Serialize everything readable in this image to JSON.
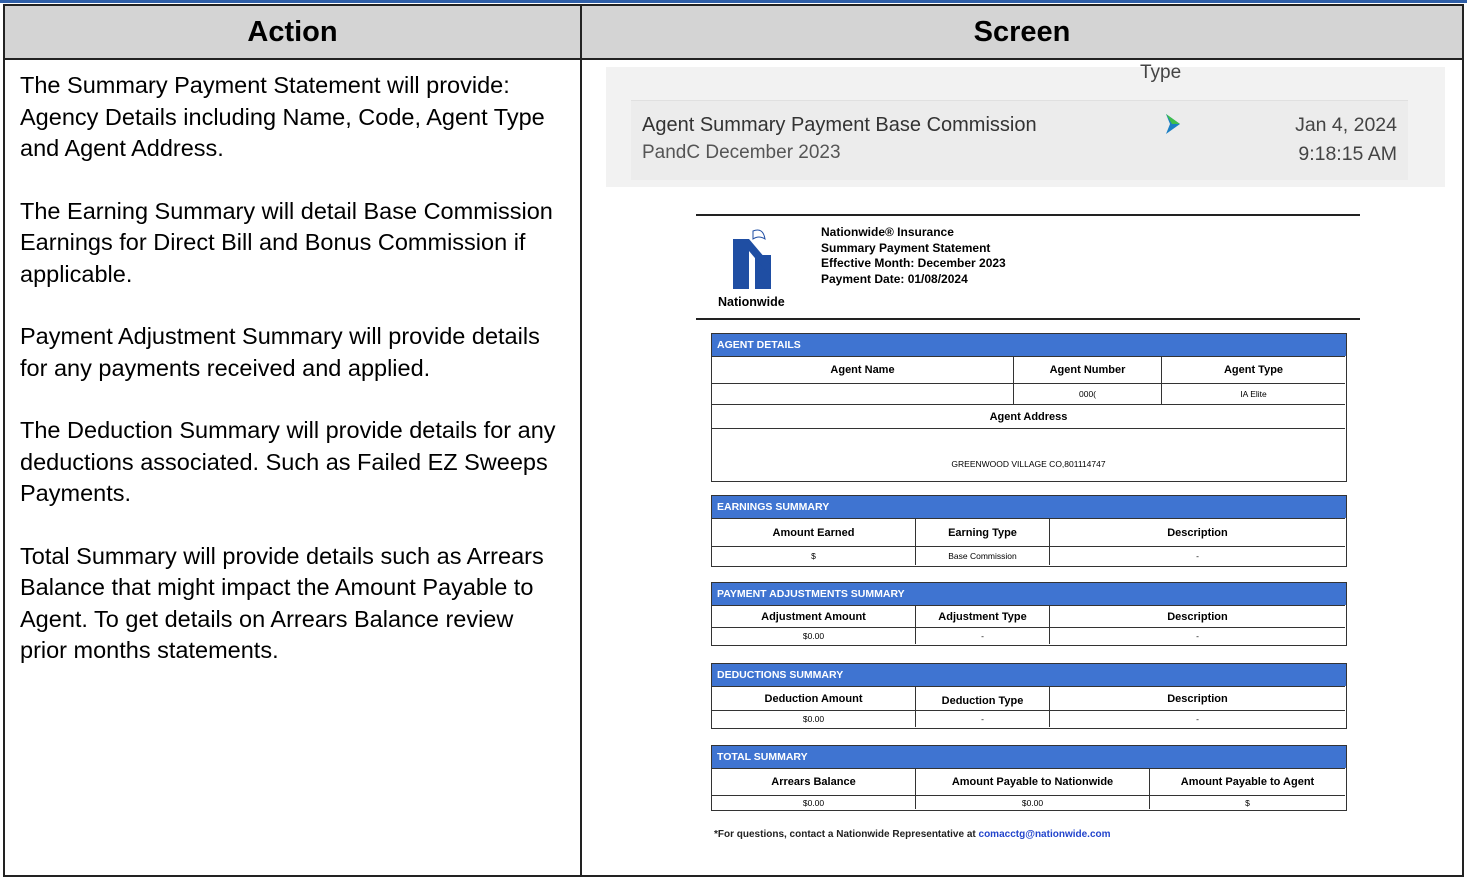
{
  "table": {
    "header_action": "Action",
    "header_screen": "Screen"
  },
  "action": {
    "paragraphs": [
      "The Summary Payment Statement will provide: Agency Details including Name, Code, Agent Type and Agent Address.",
      "The Earning Summary will detail Base Commission Earnings for Direct Bill and Bonus Commission if applicable.",
      "Payment Adjustment Summary will provide details for any payments received and applied.",
      "The Deduction Summary will provide details for any deductions associated. Such as Failed EZ Sweeps Payments.",
      "Total Summary will provide details such as Arrears Balance that might impact the Amount Payable to Agent. To get details on Arrears Balance review prior months statements."
    ]
  },
  "notification": {
    "type_label": "Type",
    "title": "Agent Summary Payment Base Commission",
    "subtitle": "PandC December 2023",
    "date": "Jan 4, 2024",
    "time": "9:18:15 AM",
    "icon": "download-arrow-icon"
  },
  "statement": {
    "logo_text": "Nationwide",
    "company": "Nationwide® Insurance",
    "title": "Summary Payment Statement",
    "effective_month": "Effective Month: December 2023",
    "payment_date": "Payment Date: 01/08/2024",
    "agent_details": {
      "bar": "AGENT DETAILS",
      "col_name": "Agent Name",
      "col_number": "Agent Number",
      "col_type": "Agent Type",
      "val_name": "",
      "val_number": "000(",
      "val_type": "IA Elite",
      "address_label": "Agent Address",
      "address_value": "GREENWOOD VILLAGE CO,801114747"
    },
    "earnings": {
      "bar": "EARNINGS SUMMARY",
      "col_amount": "Amount Earned",
      "col_type": "Earning Type",
      "col_desc": "Description",
      "val_amount": "$",
      "val_type": "Base Commission",
      "val_desc": "-"
    },
    "adjustments": {
      "bar": "PAYMENT ADJUSTMENTS SUMMARY",
      "col_amount": "Adjustment Amount",
      "col_type": "Adjustment Type",
      "col_desc": "Description",
      "val_amount": "$0.00",
      "val_type": "-",
      "val_desc": "-"
    },
    "deductions": {
      "bar": "DEDUCTIONS SUMMARY",
      "col_amount": "Deduction Amount",
      "col_type": "Deduction Type",
      "col_desc": "Description",
      "val_amount": "$0.00",
      "val_type": "-",
      "val_desc": "-"
    },
    "total": {
      "bar": "TOTAL SUMMARY",
      "col_arrears": "Arrears Balance",
      "col_nationwide": "Amount Payable to Nationwide",
      "col_agent": "Amount Payable to Agent",
      "val_arrears": "$0.00",
      "val_nationwide": "$0.00",
      "val_agent": "$"
    },
    "footer_prefix": "*For questions, contact a Nationwide Representative at ",
    "footer_email": "comacctg@nationwide.com"
  },
  "colors": {
    "section_bar": "#3f74d1",
    "header_bg": "#d4d4d4",
    "top_rule": "#2f5fa8"
  }
}
